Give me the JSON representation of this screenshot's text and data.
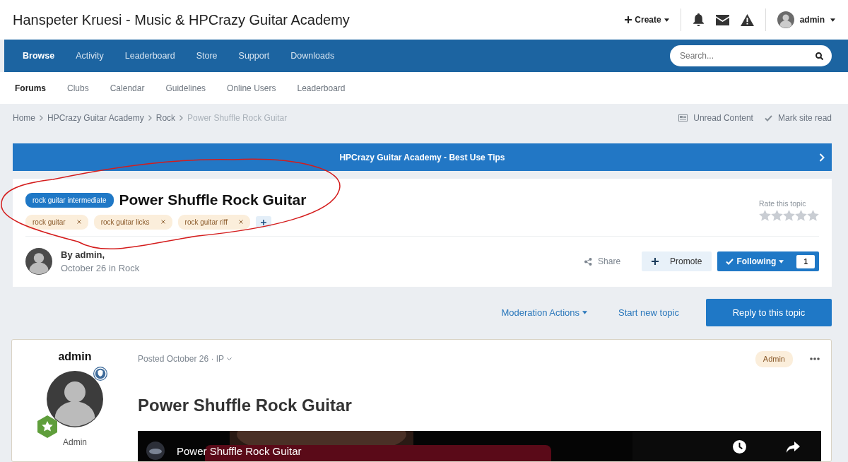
{
  "header": {
    "site_title": "Hanspeter Kruesi - Music & HPCrazy Guitar Academy",
    "create_label": "Create",
    "user_name": "admin"
  },
  "primary_nav": {
    "items": [
      {
        "label": "Browse",
        "selected": true
      },
      {
        "label": "Activity",
        "selected": false
      },
      {
        "label": "Leaderboard",
        "selected": false
      },
      {
        "label": "Store",
        "selected": false
      },
      {
        "label": "Support",
        "selected": false
      },
      {
        "label": "Downloads",
        "selected": false
      }
    ],
    "search": {
      "placeholder": "Search..."
    }
  },
  "secondary_nav": [
    {
      "label": "Forums",
      "selected": true
    },
    {
      "label": "Clubs",
      "selected": false
    },
    {
      "label": "Calendar",
      "selected": false
    },
    {
      "label": "Guidelines",
      "selected": false
    },
    {
      "label": "Online Users",
      "selected": false
    },
    {
      "label": "Leaderboard",
      "selected": false
    }
  ],
  "breadcrumb": [
    {
      "label": "Home",
      "current": false
    },
    {
      "label": "HPCrazy Guitar Academy",
      "current": false
    },
    {
      "label": "Rock",
      "current": false
    },
    {
      "label": "Power Shuffle Rock Guitar",
      "current": true
    }
  ],
  "breadcrumb_actions": [
    {
      "kind": "unread",
      "label": "Unread Content"
    },
    {
      "kind": "mark",
      "label": "Mark site read"
    }
  ],
  "banner": {
    "text": "HPCrazy Guitar Academy - Best Use Tips"
  },
  "topic": {
    "prefix": "rock guitar intermediate",
    "title": "Power Shuffle Rock Guitar",
    "tags": [
      "rock guitar",
      "rock guitar licks",
      "rock guitar riff"
    ],
    "rating": {
      "label": "Rate this topic",
      "stars": 0
    },
    "author_line": "By admin,",
    "date": "October 26 in Rock",
    "share": "Share",
    "promote": "Promote",
    "following": {
      "label": "Following",
      "count": "1"
    }
  },
  "topic_actions": {
    "moderation": "Moderation Actions",
    "start": "Start new topic",
    "reply": "Reply to this topic"
  },
  "post": {
    "author": "admin",
    "author_group": "Admin",
    "meta": "Posted October 26 · IP",
    "badge": "Admin",
    "heading": "Power Shuffle Rock Guitar",
    "video": {
      "title": "Power Shuffle Rock Guitar"
    }
  }
}
